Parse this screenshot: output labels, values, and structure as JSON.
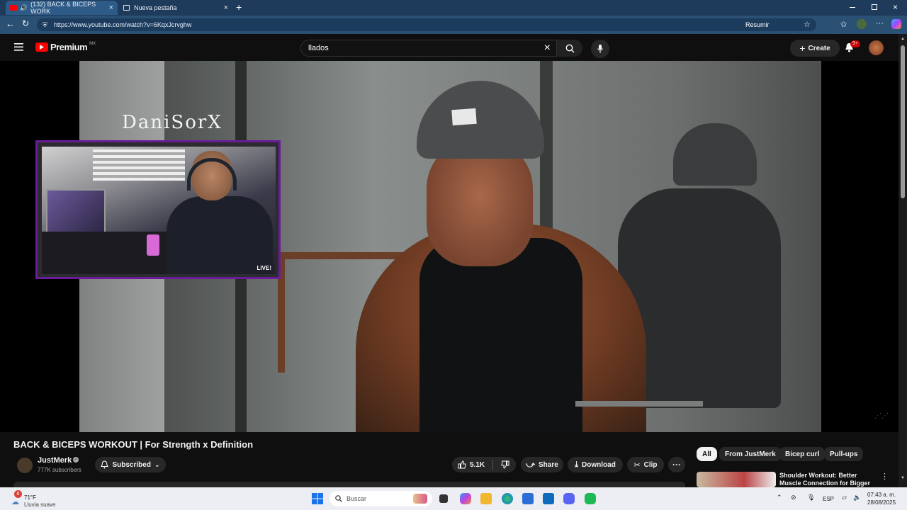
{
  "browser": {
    "tabs": [
      {
        "label": "(132) BACK & BICEPS WORK",
        "close": "×"
      },
      {
        "label": "Nueva pestaña",
        "close": "×"
      }
    ],
    "new_tab": "+",
    "url": "https://www.youtube.com/watch?v=6KqxJcrvghw",
    "resumir": "Resumir"
  },
  "youtube": {
    "logo": "Premium",
    "region": "MX",
    "search_value": "llados",
    "create_label": "Create",
    "notif_badge": "9+"
  },
  "video": {
    "overlay_name": "DaniSorX",
    "live_label": "LIVE!",
    "title": "BACK & BICEPS WORKOUT | For Strength x Definition"
  },
  "channel": {
    "name": "JustMerk",
    "subscribers": "777K subscribers",
    "subscribed_label": "Subscribed"
  },
  "actions": {
    "likes": "5.1K",
    "share": "Share",
    "download": "Download",
    "clip": "Clip"
  },
  "chips": [
    "All",
    "From JustMerk",
    "Bicep curl",
    "Pull-ups"
  ],
  "recommendation": {
    "title": "Shoulder Workout: Better Muscle Connection for Bigger"
  },
  "taskbar": {
    "weather_temp": "71°F",
    "weather_desc": "Lluvia suave",
    "weather_badge": "6",
    "search_placeholder": "Buscar",
    "lang": "ESP",
    "time": "07:43 a. m.",
    "date": "28/08/2025"
  },
  "colors": {
    "youtube_red": "#ff0000",
    "tab_bar": "#1f3b5c",
    "overlay_border": "#6a1b9a"
  }
}
